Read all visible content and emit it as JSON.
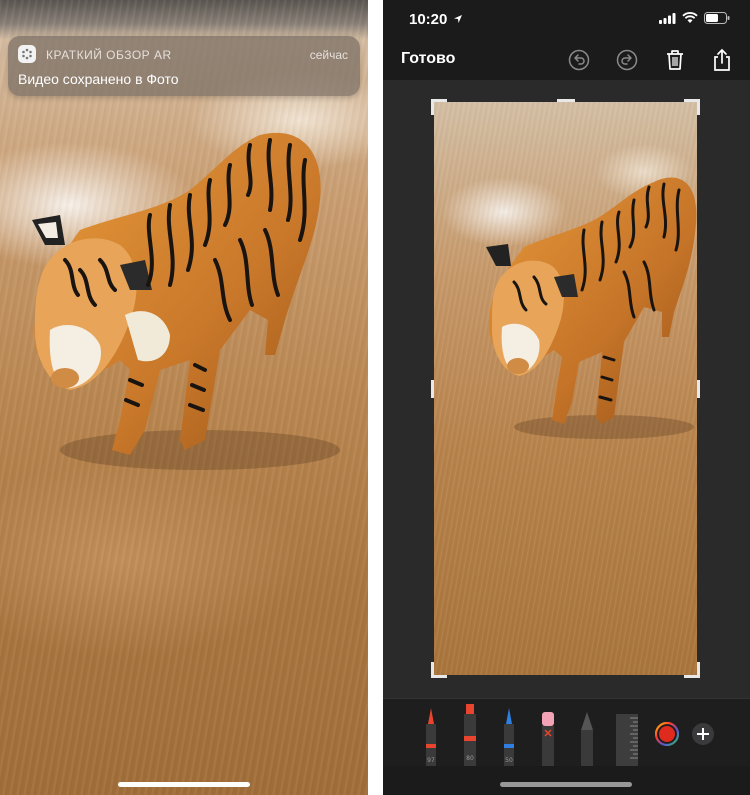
{
  "left_screen": {
    "notification": {
      "app_name": "КРАТКИЙ ОБЗОР AR",
      "time": "сейчас",
      "message": "Видео сохранено в Фото",
      "app_icon": "ar-quick-look-icon"
    }
  },
  "right_screen": {
    "status_bar": {
      "time": "10:20",
      "icons": [
        "location-arrow-icon",
        "cellular-signal-icon",
        "wifi-icon",
        "battery-icon"
      ]
    },
    "toolbar": {
      "done_label": "Готово",
      "icons": [
        "undo-icon",
        "redo-icon",
        "trash-icon",
        "share-icon"
      ]
    },
    "tools": [
      {
        "name": "pen",
        "label": "97",
        "tip_color": "#e8442e"
      },
      {
        "name": "marker",
        "label": "80",
        "tip_color": "#e8442e"
      },
      {
        "name": "pencil",
        "label": "50",
        "tip_color": "#2e7fe0"
      },
      {
        "name": "eraser",
        "label": "",
        "tip_color": "#f2a4b6"
      },
      {
        "name": "lasso",
        "label": "",
        "tip_color": "#666666"
      },
      {
        "name": "ruler",
        "label": "",
        "tip_color": "#555555"
      }
    ],
    "selected_color": "#e02a1e",
    "add_icon": "plus-icon"
  }
}
